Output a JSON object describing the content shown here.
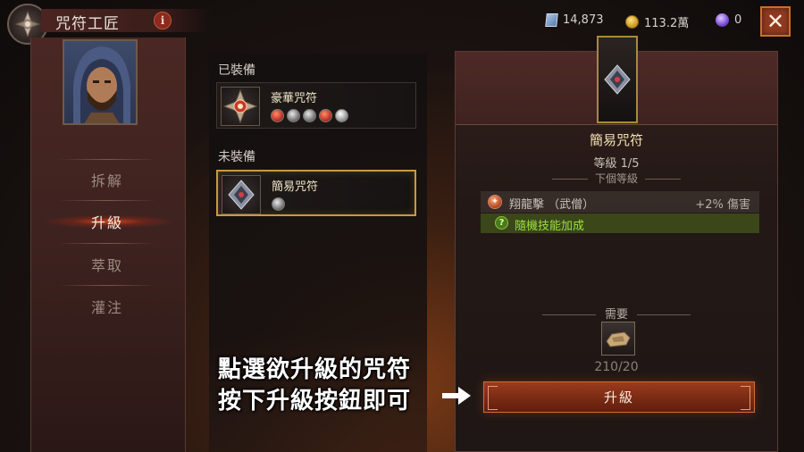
{
  "header": {
    "title": "咒符工匠",
    "info_icon": "info-icon",
    "info_label": "i",
    "close_label": "✕"
  },
  "currencies": [
    {
      "icon": "shard-icon",
      "value": "14,873"
    },
    {
      "icon": "gold-icon",
      "value": "113.2萬"
    },
    {
      "icon": "orb-icon",
      "value": "0"
    }
  ],
  "sidebar": {
    "items": [
      {
        "label": "拆解",
        "active": false
      },
      {
        "label": "升級",
        "active": true
      },
      {
        "label": "萃取",
        "active": false
      },
      {
        "label": "灌注",
        "active": false
      }
    ]
  },
  "charm_list": {
    "equipped_label": "已裝備",
    "equipped": {
      "name": "豪華咒符",
      "gems": [
        "red",
        "grey",
        "grey",
        "red",
        "white"
      ]
    },
    "unequipped_label": "未裝備",
    "unequipped": [
      {
        "name": "簡易咒符",
        "gems": [
          "grey"
        ],
        "selected": true
      }
    ]
  },
  "detail": {
    "name": "簡易咒符",
    "level": "等級 1/5",
    "next_level_label": "下個等級",
    "stat": {
      "name": "翔龍擊 （武僧）",
      "value": "+2% 傷害"
    },
    "random": {
      "icon_label": "?",
      "label": "隨機技能加成"
    },
    "requirement_label": "需要",
    "material_count": "210/20",
    "upgrade_button": "升級"
  },
  "overlay": {
    "line1": "點選欲升級的咒符",
    "line2": "按下升級按鈕即可"
  },
  "colors": {
    "accent_gold": "#c89a3a",
    "button_red": "#8f3a20",
    "random_green": "#9ae040"
  }
}
